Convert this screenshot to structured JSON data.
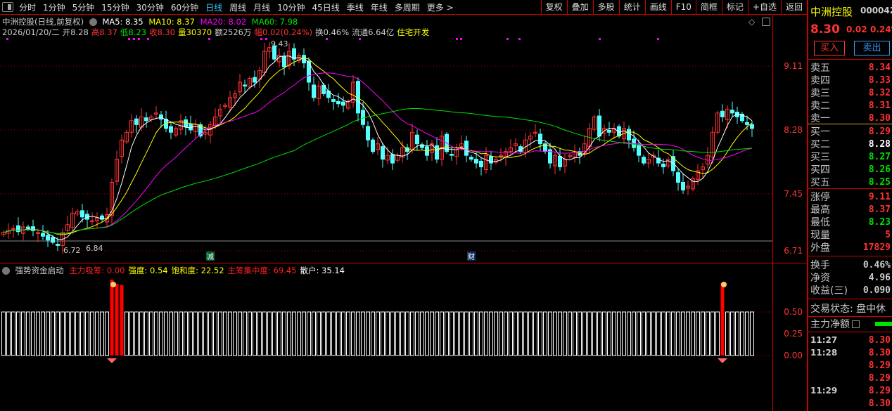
{
  "toolbar": {
    "periods": [
      "分时",
      "1分钟",
      "5分钟",
      "15分钟",
      "30分钟",
      "60分钟",
      "日线",
      "周线",
      "月线",
      "10分钟",
      "45日线",
      "季线",
      "年线",
      "多周期",
      "更多 >"
    ],
    "active_period": "日线",
    "right_buttons": [
      "复权",
      "叠加",
      "多股",
      "统计",
      "画线",
      "F10",
      "简框",
      "标记",
      "+自选",
      "返回"
    ]
  },
  "chart_header": {
    "title": "中洲控股(日线,前复权)",
    "ma5": "MA5: 8.35",
    "ma10": "MA10: 8.37",
    "ma20": "MA20: 8.02",
    "ma60": "MA60: 7.98",
    "date": "2026/01/20/二",
    "open": "开8.28",
    "high": "高8.37",
    "low": "低8.23",
    "close": "收8.30",
    "volume": "量30370",
    "amount": "额2526万",
    "change": "幅0.02(0.24%)",
    "turnover": "换0.46%",
    "float": "流通6.64亿",
    "sector": "住宅开发"
  },
  "colors": {
    "up": "#ff3333",
    "down": "#54ffff",
    "ma5": "#ffffff",
    "ma10": "#ffff00",
    "ma20": "#ff00ff",
    "ma60": "#00e000",
    "border": "#cc0000"
  },
  "price_axis": [
    "9.11",
    "8.28",
    "7.45",
    "6.71"
  ],
  "chart_labels": {
    "max": "9.43",
    "min": "6.72",
    "min2": "6.84",
    "badge_reduce": "减",
    "badge_finance": "财"
  },
  "chart_data": {
    "type": "candlestick",
    "ylim": [
      6.65,
      9.55
    ],
    "closes": [
      6.95,
      6.98,
      7.0,
      6.96,
      7.02,
      7.0,
      6.97,
      6.95,
      6.9,
      6.85,
      6.82,
      6.78,
      6.95,
      7.05,
      7.2,
      7.22,
      7.15,
      7.12,
      7.1,
      7.14,
      7.12,
      7.18,
      7.6,
      7.9,
      8.15,
      8.25,
      8.4,
      8.35,
      8.45,
      8.4,
      8.45,
      8.5,
      8.42,
      8.3,
      8.25,
      8.3,
      8.4,
      8.32,
      8.28,
      8.35,
      8.2,
      8.25,
      8.35,
      8.45,
      8.55,
      8.6,
      8.7,
      8.75,
      8.9,
      8.85,
      8.95,
      8.9,
      9.05,
      9.3,
      9.35,
      9.2,
      9.25,
      9.1,
      9.3,
      9.2,
      9.25,
      9.15,
      8.9,
      8.7,
      8.85,
      8.75,
      8.7,
      8.65,
      8.62,
      8.6,
      8.65,
      8.9,
      8.5,
      8.35,
      8.15,
      8.0,
      8.1,
      7.9,
      7.95,
      7.85,
      7.95,
      8.05,
      8.0,
      8.25,
      8.1,
      8.05,
      7.95,
      8.1,
      7.9,
      8.2,
      8.0,
      7.95,
      8.05,
      8.1,
      7.95,
      7.9,
      7.85,
      7.8,
      7.95,
      7.85,
      7.9,
      7.95,
      8.0,
      8.05,
      8.1,
      8.0,
      8.15,
      8.2,
      8.25,
      8.1,
      8.0,
      7.85,
      7.95,
      7.8,
      7.9,
      7.95,
      8.0,
      7.95,
      8.1,
      8.3,
      8.45,
      8.2,
      8.3,
      8.25,
      8.3,
      8.2,
      8.3,
      8.15,
      8.05,
      7.95,
      7.85,
      7.9,
      7.95,
      7.85,
      7.8,
      7.9,
      7.75,
      7.6,
      7.5,
      7.55,
      7.65,
      7.75,
      7.8,
      7.95,
      8.25,
      8.5,
      8.45,
      8.55,
      8.5,
      8.45,
      8.4,
      8.35,
      8.3
    ]
  },
  "indicator": {
    "name": "强势资金启动",
    "items": [
      {
        "label": "主力吸筹: 0.00",
        "color": "#ff2020"
      },
      {
        "label": "强度: 0.54",
        "color": "#ffff00"
      },
      {
        "label": "饱和度: 22.52",
        "color": "#ffff00"
      },
      {
        "label": "主筹集中度: 69.45",
        "color": "#ff2020"
      },
      {
        "label": "散户: 35.14",
        "color": "#ffffff"
      }
    ],
    "axis": [
      "0.50",
      "0.25",
      "0.00"
    ],
    "base_value": 0.5,
    "signals": [
      {
        "index": 22,
        "value": 0.87
      },
      {
        "index": 23,
        "value": 0.82
      },
      {
        "index": 24,
        "value": 0.81
      },
      {
        "index": 146,
        "value": 0.83
      }
    ]
  },
  "quote": {
    "name": "中洲控股",
    "code": "000042",
    "price": "8.30",
    "change": "0.02",
    "pct": "0.24%",
    "buy_label": "买入",
    "sell_label": "卖出",
    "asks": [
      {
        "l": "卖五",
        "v": "8.34"
      },
      {
        "l": "卖四",
        "v": "8.33"
      },
      {
        "l": "卖三",
        "v": "8.32"
      },
      {
        "l": "卖二",
        "v": "8.31"
      },
      {
        "l": "卖一",
        "v": "8.30"
      }
    ],
    "bids": [
      {
        "l": "买一",
        "v": "8.29",
        "c": "red"
      },
      {
        "l": "买二",
        "v": "8.28",
        "c": "white"
      },
      {
        "l": "买三",
        "v": "8.27",
        "c": "green"
      },
      {
        "l": "买四",
        "v": "8.26",
        "c": "green"
      },
      {
        "l": "买五",
        "v": "8.25",
        "c": "green"
      }
    ],
    "stats": [
      {
        "l": "涨停",
        "v": "9.11",
        "c": "red"
      },
      {
        "l": "最高",
        "v": "8.37",
        "c": "red"
      },
      {
        "l": "最低",
        "v": "8.23",
        "c": "green"
      },
      {
        "l": "现量",
        "v": "5",
        "c": "red"
      },
      {
        "l": "外盘",
        "v": "17829",
        "c": "red"
      }
    ],
    "fin": [
      {
        "l": "换手",
        "v": "0.46%"
      },
      {
        "l": "净资",
        "v": "4.96"
      },
      {
        "l": "收益(三)",
        "v": "0.090"
      }
    ],
    "status": "交易状态: 盘中休",
    "net_label": "主力净额",
    "ticks": [
      {
        "t": "11:27",
        "v": "8.30"
      },
      {
        "t": "11:28",
        "v": "8.30"
      },
      {
        "t": "",
        "v": "8.29"
      },
      {
        "t": "",
        "v": "8.29"
      },
      {
        "t": "11:29",
        "v": "8.29"
      },
      {
        "t": "",
        "v": "8.30"
      }
    ]
  }
}
